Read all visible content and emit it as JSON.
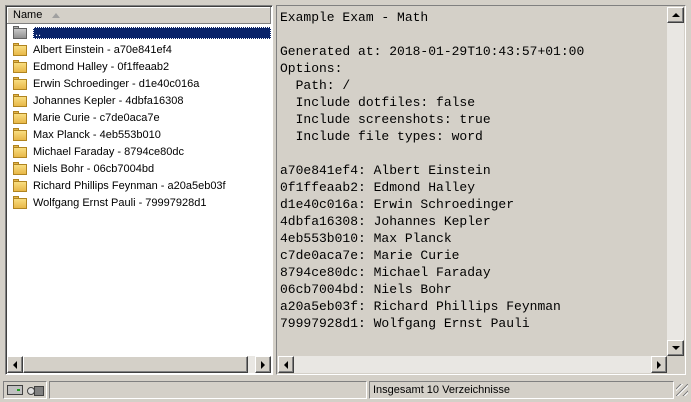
{
  "file_list": {
    "column_header": "Name",
    "items": [
      {
        "label": "..",
        "type": "parent",
        "selected": true
      },
      {
        "label": "Albert Einstein - a70e841ef4",
        "type": "folder"
      },
      {
        "label": "Edmond Halley - 0f1ffeaab2",
        "type": "folder"
      },
      {
        "label": "Erwin Schroedinger - d1e40c016a",
        "type": "folder"
      },
      {
        "label": "Johannes Kepler - 4dbfa16308",
        "type": "folder"
      },
      {
        "label": "Marie Curie - c7de0aca7e",
        "type": "folder"
      },
      {
        "label": "Max Planck - 4eb553b010",
        "type": "folder"
      },
      {
        "label": "Michael Faraday - 8794ce80dc",
        "type": "folder"
      },
      {
        "label": "Niels Bohr - 06cb7004bd",
        "type": "folder"
      },
      {
        "label": "Richard Phillips Feynman - a20a5eb03f",
        "type": "folder"
      },
      {
        "label": "Wolfgang Ernst Pauli - 79997928d1",
        "type": "folder"
      }
    ]
  },
  "preview": {
    "lines": [
      "Example Exam - Math",
      "",
      "Generated at: 2018-01-29T10:43:57+01:00",
      "Options:",
      "  Path: /",
      "  Include dotfiles: false",
      "  Include screenshots: true",
      "  Include file types: word",
      "",
      "a70e841ef4: Albert Einstein",
      "0f1ffeaab2: Edmond Halley",
      "d1e40c016a: Erwin Schroedinger",
      "4dbfa16308: Johannes Kepler",
      "4eb553b010: Max Planck",
      "c7de0aca7e: Marie Curie",
      "8794ce80dc: Michael Faraday",
      "06cb7004bd: Niels Bohr",
      "a20a5eb03f: Richard Phillips Feynman",
      "79997928d1: Wolfgang Ernst Pauli"
    ]
  },
  "status_bar": {
    "text": "Insgesamt 10 Verzeichnisse"
  },
  "colors": {
    "selection": "#0a246a",
    "window_bg": "#d4d0c8"
  }
}
